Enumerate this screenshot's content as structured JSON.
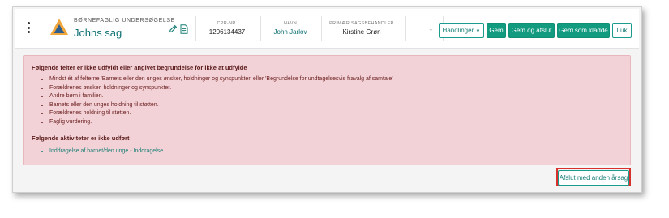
{
  "header": {
    "case_type": "BØRNEFAGLIG UNDERSØGELSE",
    "case_name": "Johns sag",
    "cpr_label": "CPR-NR.",
    "cpr_value": "1206134437",
    "name_label": "NAVN",
    "name_value": "John Jarlov",
    "handler_label": "PRIMÆR SAGSBEHANDLER",
    "handler_value": "Kirstine Grøn"
  },
  "toolbar": {
    "actions_label": "Handlinger",
    "save_label": "Gem",
    "save_close_label": "Gem og afslut",
    "save_draft_label": "Gem som kladde",
    "close_label": "Luk"
  },
  "alert": {
    "missing_title": "Følgende felter er ikke udfyldt eller angivet begrundelse for ikke at udfylde",
    "missing_items": [
      "Mindst ét af felterne 'Barnets eller den unges ønsker, holdninger og synspunkter' eller 'Begrundelse for undtagelsesvis fravalg af samtale'",
      "Forældrenes ønsker, holdninger og synspunkter.",
      "Andre børn i familien.",
      "Barnets eller den unges holdning til støtten.",
      "Forældrenes holdning til støtten.",
      "Faglig vurdering."
    ],
    "activities_title": "Følgende aktiviteter er ikke udført",
    "activity_items": [
      "Inddragelse af barnet/den unge - Inddragelse"
    ]
  },
  "footer": {
    "finish_other_label": "Afslut med anden årsag"
  },
  "colors": {
    "accent": "#139b80",
    "alert_bg": "#f2d2d6",
    "highlight": "#d9302b"
  },
  "icons": {
    "menu": "kebab-menu-icon",
    "case_logo": "triangle-logo-icon",
    "edit": "pencil-icon",
    "document": "document-icon"
  }
}
